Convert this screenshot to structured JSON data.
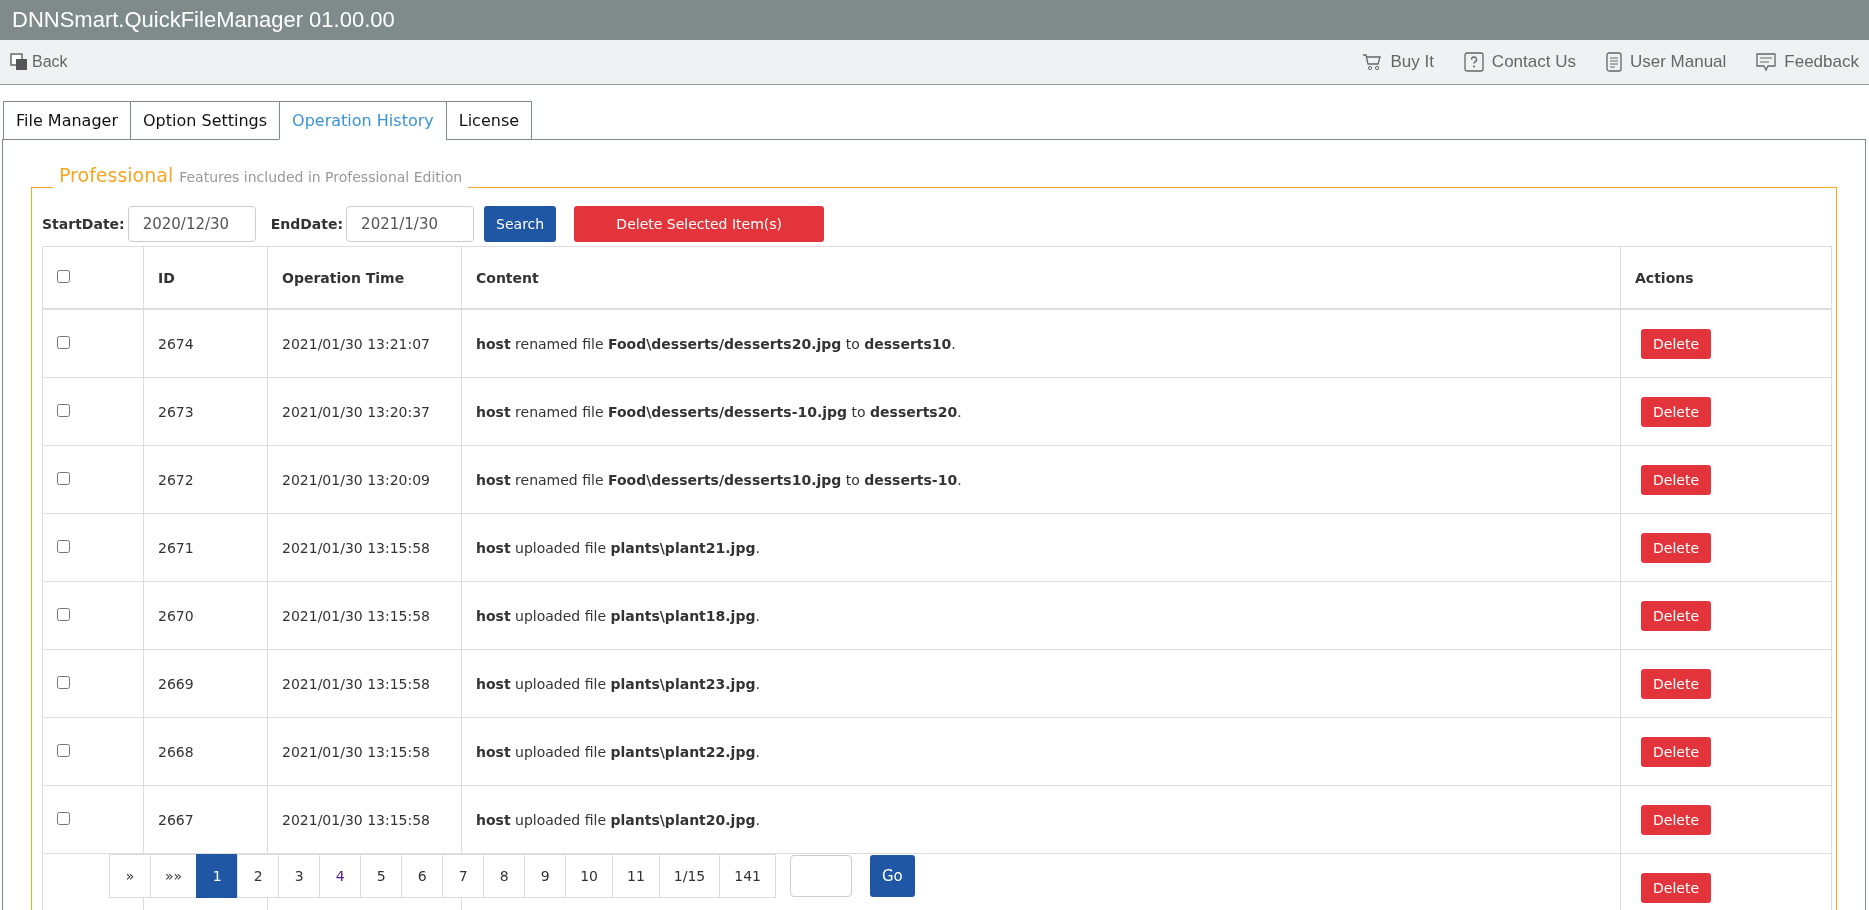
{
  "window": {
    "title": "DNNSmart.QuickFileManager 01.00.00"
  },
  "toolbar": {
    "back": "Back",
    "links": [
      {
        "kind": "cart",
        "label": "Buy It"
      },
      {
        "kind": "help",
        "label": "Contact Us"
      },
      {
        "kind": "manual",
        "label": "User Manual"
      },
      {
        "kind": "feedback",
        "label": "Feedback"
      }
    ]
  },
  "tabs": [
    {
      "label": "File Manager",
      "selected": false
    },
    {
      "label": "Option Settings",
      "selected": false
    },
    {
      "label": "Operation History",
      "selected": true
    },
    {
      "label": "License",
      "selected": false
    }
  ],
  "section": {
    "title": "Professional",
    "subtitle": "Features included in Professional Edition"
  },
  "filters": {
    "start_label": "StartDate:",
    "start_value": "2020/12/30",
    "end_label": "EndDate:",
    "end_value": "2021/1/30",
    "search": "Search",
    "delete_selected": "Delete Selected Item(s)"
  },
  "table": {
    "select_all": false,
    "columns": [
      "ID",
      "Operation Time",
      "Content",
      "Actions"
    ],
    "rows": [
      {
        "checked": false,
        "id": "2674",
        "time": "2021/01/30 13:21:07",
        "content": "**host** renamed file **Food\\desserts/desserts20.jpg** to **desserts10**.",
        "action": "Delete"
      },
      {
        "checked": false,
        "id": "2673",
        "time": "2021/01/30 13:20:37",
        "content": "**host** renamed file **Food\\desserts/desserts-10.jpg** to **desserts20**.",
        "action": "Delete"
      },
      {
        "checked": false,
        "id": "2672",
        "time": "2021/01/30 13:20:09",
        "content": "**host** renamed file **Food\\desserts/desserts10.jpg** to **desserts-10**.",
        "action": "Delete"
      },
      {
        "checked": false,
        "id": "2671",
        "time": "2021/01/30 13:15:58",
        "content": "**host** uploaded file **plants\\plant21.jpg**.",
        "action": "Delete"
      },
      {
        "checked": false,
        "id": "2670",
        "time": "2021/01/30 13:15:58",
        "content": "**host** uploaded file **plants\\plant18.jpg**.",
        "action": "Delete"
      },
      {
        "checked": false,
        "id": "2669",
        "time": "2021/01/30 13:15:58",
        "content": "**host** uploaded file **plants\\plant23.jpg**.",
        "action": "Delete"
      },
      {
        "checked": false,
        "id": "2668",
        "time": "2021/01/30 13:15:58",
        "content": "**host** uploaded file **plants\\plant22.jpg**.",
        "action": "Delete"
      },
      {
        "checked": false,
        "id": "2667",
        "time": "2021/01/30 13:15:58",
        "content": "**host** uploaded file **plants\\plant20.jpg**.",
        "action": "Delete"
      },
      {
        "action": "Delete"
      }
    ]
  },
  "pagination": {
    "pages": [
      {
        "label": "»",
        "selected": false,
        "visited": false
      },
      {
        "label": "»»",
        "selected": false,
        "visited": false
      },
      {
        "label": "1",
        "selected": true,
        "visited": false
      },
      {
        "label": "2",
        "selected": false,
        "visited": false
      },
      {
        "label": "3",
        "selected": false,
        "visited": false
      },
      {
        "label": "4",
        "selected": false,
        "visited": true
      },
      {
        "label": "5",
        "selected": false,
        "visited": false
      },
      {
        "label": "6",
        "selected": false,
        "visited": false
      },
      {
        "label": "7",
        "selected": false,
        "visited": false
      },
      {
        "label": "8",
        "selected": false,
        "visited": false
      },
      {
        "label": "9",
        "selected": false,
        "visited": false
      },
      {
        "label": "10",
        "selected": false,
        "visited": false
      },
      {
        "label": "11",
        "selected": false,
        "visited": false
      },
      {
        "label": "1/15",
        "selected": false,
        "visited": false
      },
      {
        "label": "141",
        "selected": false,
        "visited": false
      }
    ],
    "go": "Go"
  }
}
